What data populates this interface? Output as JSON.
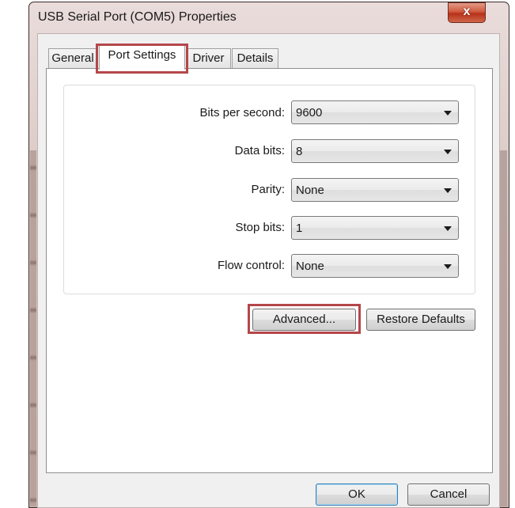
{
  "window": {
    "title": "USB Serial Port (COM5) Properties",
    "close_label": "x"
  },
  "tabs": [
    {
      "label": "General",
      "active": false
    },
    {
      "label": "Port Settings",
      "active": true
    },
    {
      "label": "Driver",
      "active": false
    },
    {
      "label": "Details",
      "active": false
    }
  ],
  "port_settings": {
    "fields": [
      {
        "label": "Bits per second:",
        "value": "9600"
      },
      {
        "label": "Data bits:",
        "value": "8"
      },
      {
        "label": "Parity:",
        "value": "None"
      },
      {
        "label": "Stop bits:",
        "value": "1"
      },
      {
        "label": "Flow control:",
        "value": "None"
      }
    ],
    "advanced_label": "Advanced...",
    "restore_defaults_label": "Restore Defaults"
  },
  "footer": {
    "ok_label": "OK",
    "cancel_label": "Cancel"
  },
  "colors": {
    "highlight": "#b4474a",
    "close_button": "#c9452a"
  }
}
